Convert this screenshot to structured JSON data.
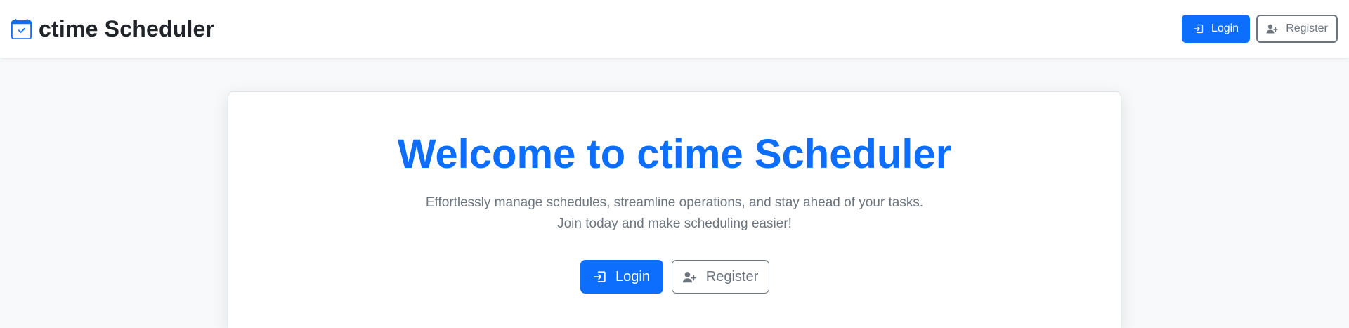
{
  "header": {
    "brand": "ctime Scheduler",
    "brand_icon": "calendar-check-icon",
    "login_label": "Login",
    "register_label": "Register"
  },
  "hero": {
    "title": "Welcome to ctime Scheduler",
    "subtitle_line1": "Effortlessly manage schedules, streamline operations, and stay ahead of your tasks.",
    "subtitle_line2": "Join today and make scheduling easier!",
    "login_label": "Login",
    "register_label": "Register"
  },
  "icons": {
    "login": "login-icon",
    "register": "person-add-icon"
  },
  "colors": {
    "primary": "#0d6efd",
    "secondary": "#6c757d"
  }
}
